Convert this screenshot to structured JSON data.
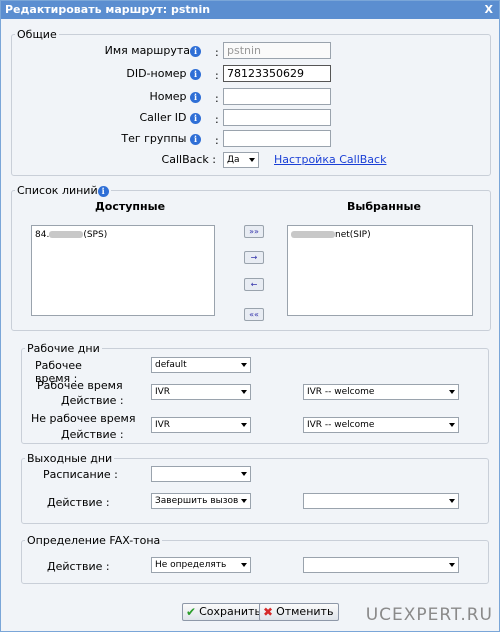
{
  "title": "Редактировать маршрут: pstnin",
  "close_label": "X",
  "general": {
    "legend": "Общие",
    "route_name_label": "Имя маршрута",
    "route_name_value": "pstnin",
    "did_label": "DID-номер",
    "did_value": "78123350629",
    "number_label": "Номер",
    "number_value": "",
    "callerid_label": "Caller ID",
    "callerid_value": "",
    "group_tag_label": "Тег группы",
    "group_tag_value": "",
    "callback_label": "CallBack",
    "callback_value": "Да",
    "callback_link": "Настройка CallBack",
    "colon": ":"
  },
  "lines": {
    "legend": "Список линий",
    "available_header": "Доступные",
    "selected_header": "Выбранные",
    "available_items": [
      {
        "prefix": "84.",
        "suffix": "(SPS)"
      }
    ],
    "selected_items": [
      {
        "prefix": "",
        "suffix": "net(SIP)"
      }
    ],
    "btn_all_right": "»»",
    "btn_right": "→",
    "btn_left": "←",
    "btn_all_left": "««"
  },
  "workdays": {
    "legend": "Рабочие дни",
    "work_time_label": "Рабочее время :",
    "work_time_value": "default",
    "work_action_label_1": "Рабочее время",
    "work_action_label_2": "Действие :",
    "work_action_value": "IVR",
    "work_action_target": "IVR -- welcome",
    "offwork_action_label_1": "Не рабочее время",
    "offwork_action_label_2": "Действие :",
    "offwork_action_value": "IVR",
    "offwork_action_target": "IVR -- welcome"
  },
  "weekends": {
    "legend": "Выходные дни",
    "schedule_label": "Расписание :",
    "schedule_value": "",
    "action_label": "Действие :",
    "action_value": "Завершить вызов",
    "action_target": ""
  },
  "fax": {
    "legend": "Определение FAX-тона",
    "action_label": "Действие :",
    "action_value": "Не определять",
    "action_target": ""
  },
  "buttons": {
    "save": "Сохранить",
    "cancel": "Отменить"
  },
  "watermark": "UCEXPERT.RU",
  "colors": {
    "titlebar": "#5b8ed0",
    "link": "#1a3fd6",
    "info": "#2f6fd6"
  }
}
